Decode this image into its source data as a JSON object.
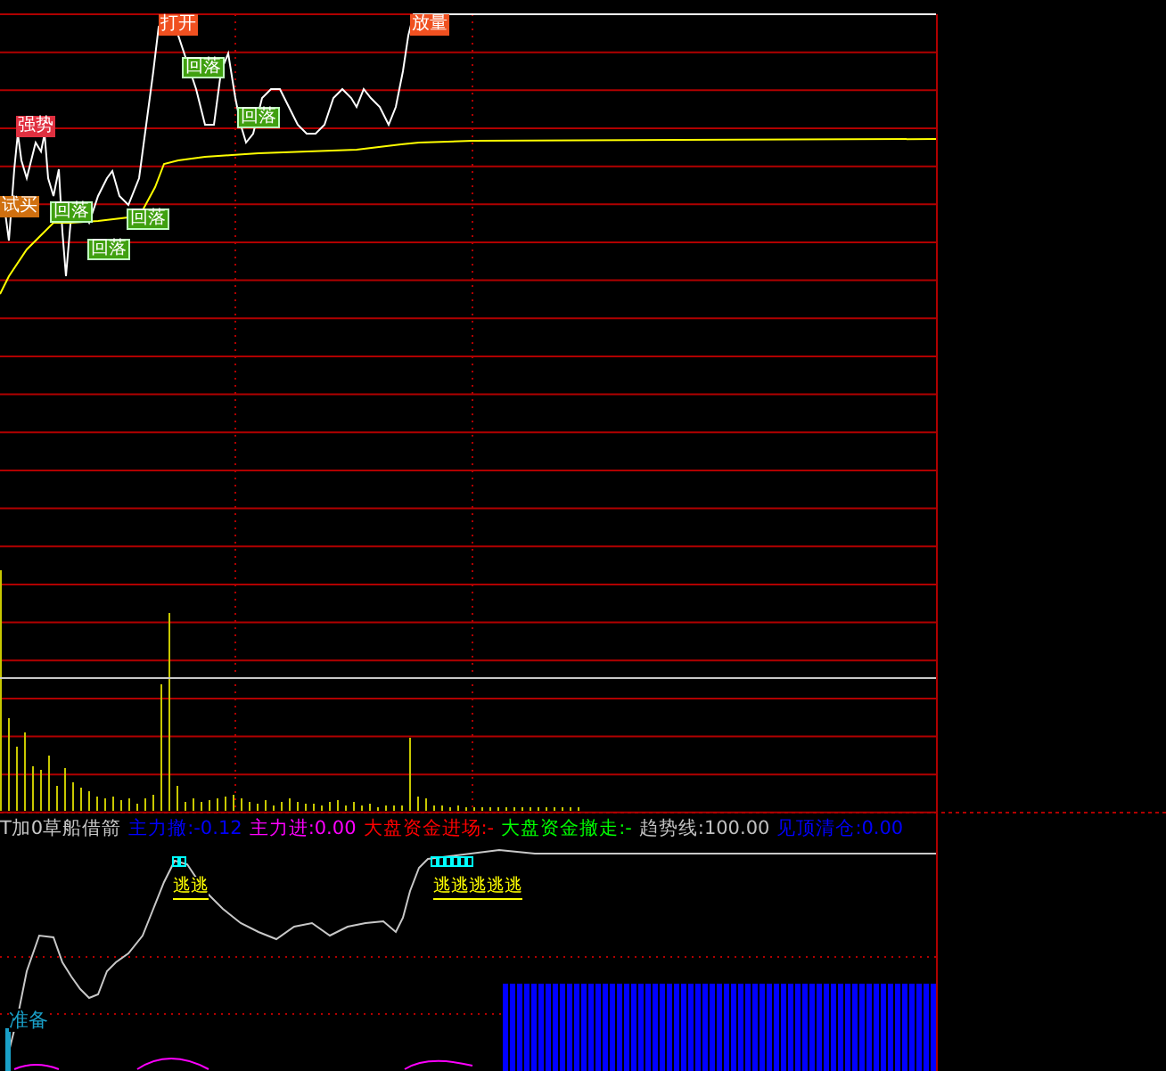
{
  "signals": [
    {
      "text": "打开",
      "kind": "open"
    },
    {
      "text": "放量",
      "kind": "open"
    },
    {
      "text": "回落",
      "kind": "fall"
    },
    {
      "text": "回落",
      "kind": "fall"
    },
    {
      "text": "强势",
      "kind": "strong"
    },
    {
      "text": "试买",
      "kind": "buy"
    },
    {
      "text": "回落",
      "kind": "fall"
    },
    {
      "text": "回落",
      "kind": "fall"
    },
    {
      "text": "回落",
      "kind": "fall"
    }
  ],
  "indicator": {
    "name": "T加0草船借箭",
    "values": [
      {
        "label": "主力撤:",
        "value": "-0.12",
        "color": "#0000ff"
      },
      {
        "label": "主力进:",
        "value": "0.00",
        "color": "#ff00ff"
      },
      {
        "label": "大盘资金进场:",
        "value": "-",
        "color": "#ff0000"
      },
      {
        "label": "大盘资金撤走:",
        "value": "-",
        "color": "#00ff00"
      },
      {
        "label": "趋势线:",
        "value": "100.00",
        "color": "#c0c0c0"
      },
      {
        "label": "见顶清仓:",
        "value": "0.00",
        "color": "#0000ff"
      }
    ]
  },
  "escape_signals": [
    "逃逃",
    "逃逃逃逃逃"
  ],
  "ready_signal": "准备"
}
